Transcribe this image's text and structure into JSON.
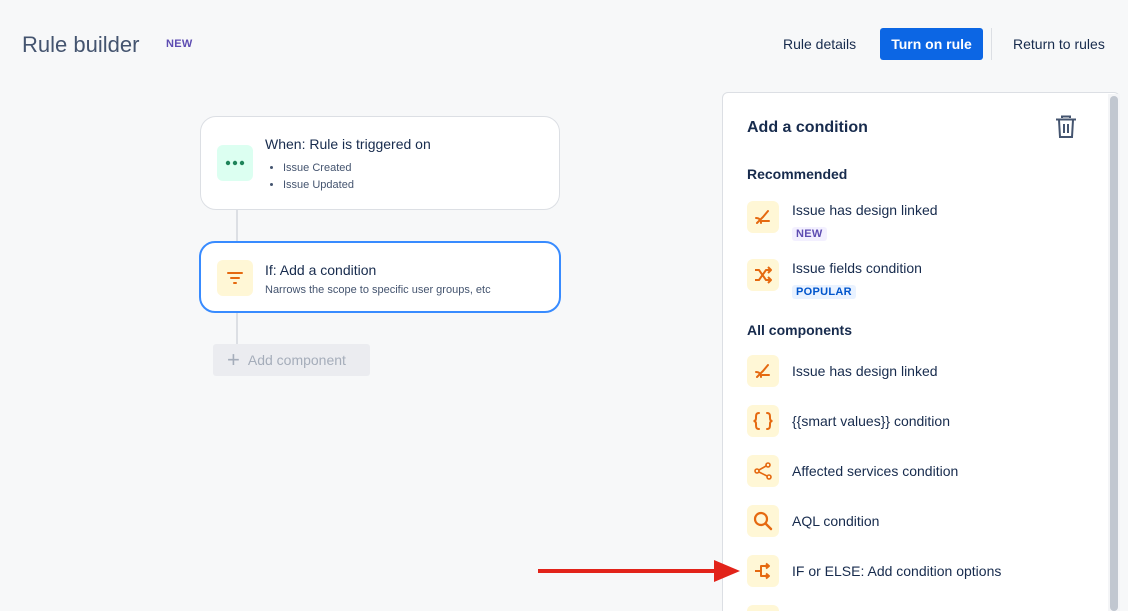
{
  "header": {
    "title": "Rule builder",
    "badge": "NEW",
    "rule_details": "Rule details",
    "turn_on_rule": "Turn on rule",
    "return_to_rules": "Return to rules"
  },
  "canvas": {
    "trigger": {
      "title": "When: Rule is triggered on",
      "events": [
        "Issue Created",
        "Issue Updated"
      ],
      "icon": "more-dots-icon"
    },
    "condition": {
      "title": "If: Add a condition",
      "subtitle": "Narrows the scope to specific user groups, etc",
      "icon": "filter-icon"
    },
    "add_component": "Add component"
  },
  "panel": {
    "title": "Add a condition",
    "recommended_heading": "Recommended",
    "recommended": [
      {
        "label": "Issue has design linked",
        "badge": "NEW",
        "icon": "design-link-icon"
      },
      {
        "label": "Issue fields condition",
        "badge": "POPULAR",
        "icon": "shuffle-icon"
      }
    ],
    "all_heading": "All components",
    "all": [
      {
        "label": "Issue has design linked",
        "icon": "design-link-icon"
      },
      {
        "label": "{{smart values}} condition",
        "icon": "curly-braces-icon"
      },
      {
        "label": "Affected services condition",
        "icon": "services-icon"
      },
      {
        "label": "AQL condition",
        "icon": "search-icon"
      },
      {
        "label": "IF or ELSE: Add condition options",
        "icon": "branch-icon"
      }
    ]
  },
  "colors": {
    "primary": "#0c66e4",
    "selected_border": "#388bff",
    "icon_orange": "#e56910",
    "icon_green": "#1f845a",
    "arrow_red": "#e2231a"
  }
}
